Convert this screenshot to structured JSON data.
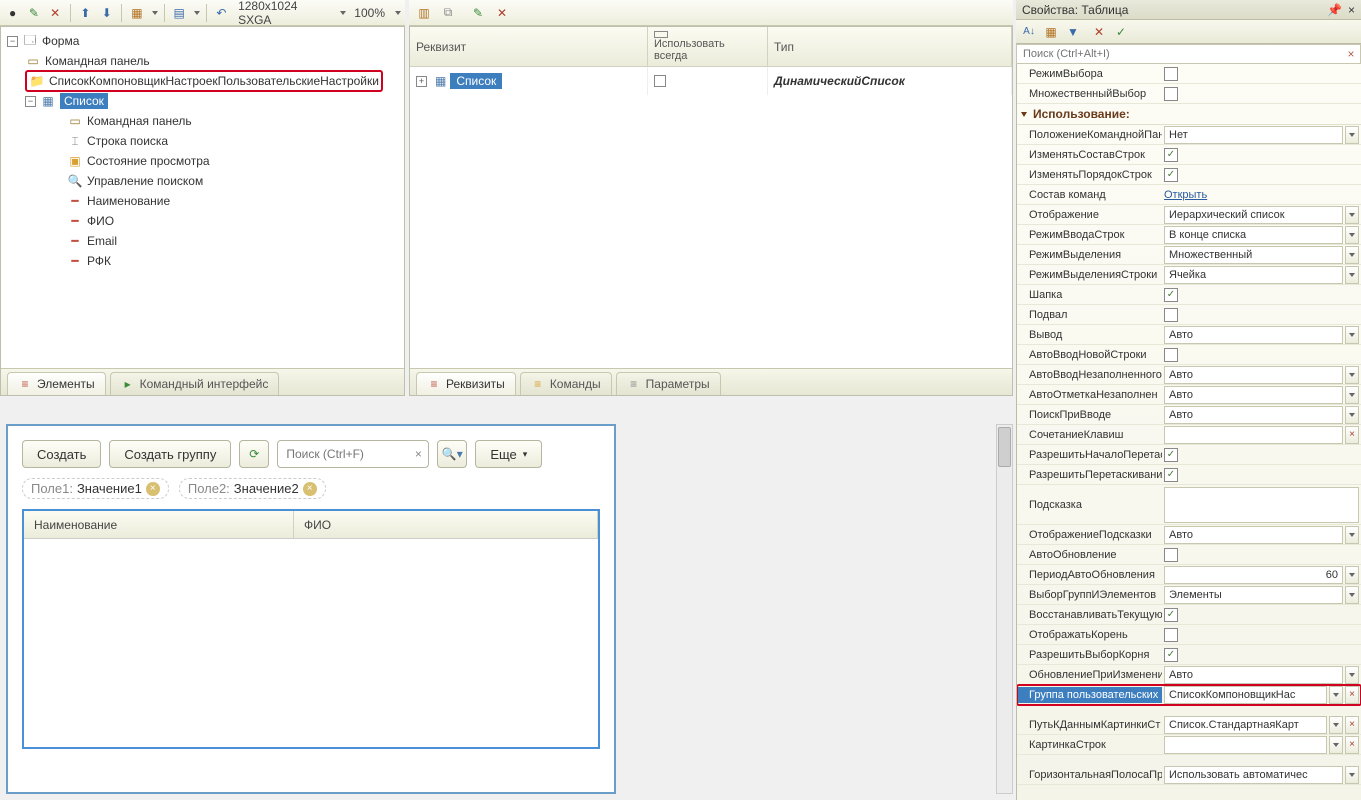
{
  "top_toolbar": {
    "resolution": "1280x1024 SXGA",
    "zoom": "100%"
  },
  "form_tree": {
    "root": "Форма",
    "items": [
      {
        "label": "Командная панель",
        "icon": "toolbar"
      },
      {
        "label": "СписокКомпоновщикНастроекПользовательскиеНастройки",
        "icon": "folder",
        "highlighted": true
      },
      {
        "label": "Список",
        "icon": "table",
        "selected": true,
        "children": [
          {
            "label": "Командная панель",
            "icon": "toolbar"
          },
          {
            "label": "Строка поиска",
            "icon": "search-row"
          },
          {
            "label": "Состояние просмотра",
            "icon": "view-state"
          },
          {
            "label": "Управление поиском",
            "icon": "search-mgmt"
          },
          {
            "label": "Наименование",
            "icon": "field"
          },
          {
            "label": "ФИО",
            "icon": "field"
          },
          {
            "label": "Email",
            "icon": "field"
          },
          {
            "label": "РФК",
            "icon": "field"
          }
        ]
      }
    ]
  },
  "left_tabs": [
    {
      "label": "Элементы",
      "active": true,
      "icon": "elements"
    },
    {
      "label": "Командный интерфейс",
      "active": false,
      "icon": "cmd-iface"
    }
  ],
  "mid_grid": {
    "columns": [
      "Реквизит",
      "Использовать всегда",
      "Тип"
    ],
    "row": {
      "name": "Список",
      "use_always": false,
      "type": "ДинамическийСписок"
    }
  },
  "mid_tabs": [
    {
      "label": "Реквизиты",
      "icon": "attrs"
    },
    {
      "label": "Команды",
      "icon": "cmds"
    },
    {
      "label": "Параметры",
      "icon": "params"
    }
  ],
  "preview": {
    "buttons": {
      "create": "Создать",
      "create_group": "Создать группу",
      "more": "Еще"
    },
    "search_placeholder": "Поиск (Ctrl+F)",
    "filters": [
      {
        "label": "Поле1:",
        "value": "Значение1"
      },
      {
        "label": "Поле2:",
        "value": "Значение2"
      }
    ],
    "columns": [
      "Наименование",
      "ФИО"
    ]
  },
  "right": {
    "title": "Свойства: Таблица",
    "search_placeholder": "Поиск (Ctrl+Alt+I)"
  },
  "props": {
    "rezhim_vybora": {
      "label": "РежимВыбора",
      "checked": false
    },
    "mnozh_vybor": {
      "label": "МножественныйВыбор",
      "checked": false
    },
    "section_use": "Использование:",
    "polozhenie_kp": {
      "label": "ПоложениеКоманднойПан",
      "value": "Нет"
    },
    "izm_sostav": {
      "label": "ИзменятьСоставСтрок",
      "checked": true
    },
    "izm_poryadok": {
      "label": "ИзменятьПорядокСтрок",
      "checked": true
    },
    "sostav_komand": {
      "label": "Состав команд",
      "value": "Открыть"
    },
    "otobrazhenie": {
      "label": "Отображение",
      "value": "Иерархический список"
    },
    "rezhim_vvoda": {
      "label": "РежимВводаСтрок",
      "value": "В конце списка"
    },
    "rezhim_vydel": {
      "label": "РежимВыделения",
      "value": "Множественный"
    },
    "rezhim_vydel_str": {
      "label": "РежимВыделенияСтроки",
      "value": "Ячейка"
    },
    "shapka": {
      "label": "Шапка",
      "checked": true
    },
    "podval": {
      "label": "Подвал",
      "checked": false
    },
    "vyvod": {
      "label": "Вывод",
      "value": "Авто"
    },
    "auto_vvod_nov": {
      "label": "АвтоВводНовойСтроки",
      "checked": false
    },
    "auto_vvod_nez": {
      "label": "АвтоВводНезаполненного",
      "value": "Авто"
    },
    "auto_otm_nez": {
      "label": "АвтоОтметкаНезаполнен",
      "value": "Авто"
    },
    "poisk_vvode": {
      "label": "ПоискПриВводе",
      "value": "Авто"
    },
    "sochet_klav": {
      "label": "СочетаниеКлавиш",
      "value": ""
    },
    "razr_nach_per": {
      "label": "РазрешитьНачалоПеретас",
      "checked": true
    },
    "razr_per": {
      "label": "РазрешитьПеретаскивани",
      "checked": true
    },
    "podskazka": {
      "label": "Подсказка",
      "value": ""
    },
    "otobr_pod": {
      "label": "ОтображениеПодсказки",
      "value": "Авто"
    },
    "auto_obn": {
      "label": "АвтоОбновление",
      "checked": false
    },
    "period_auto": {
      "label": "ПериодАвтоОбновления",
      "value": "60"
    },
    "vybor_grp": {
      "label": "ВыборГруппИЭлементов",
      "value": "Элементы"
    },
    "vosst_tek": {
      "label": "ВосстанавливатьТекущую",
      "checked": true
    },
    "otobr_koren": {
      "label": "ОтображатьКорень",
      "checked": false
    },
    "razr_koren": {
      "label": "РазрешитьВыборКорня",
      "checked": true
    },
    "obn_izm": {
      "label": "ОбновлениеПриИзменени",
      "value": "Авто"
    },
    "grp_polz": {
      "label": "Группа пользовательских",
      "value": "СписокКомпоновщикНас"
    },
    "put_dannym": {
      "label": "ПутьКДаннымКартинкиСт",
      "value": "Список.СтандартнаяКарт"
    },
    "kartinka": {
      "label": "КартинкаСтрок",
      "value": ""
    },
    "gor_polosa": {
      "label": "ГоризонтальнаяПолосаПр",
      "value": "Использовать автоматичес"
    }
  }
}
